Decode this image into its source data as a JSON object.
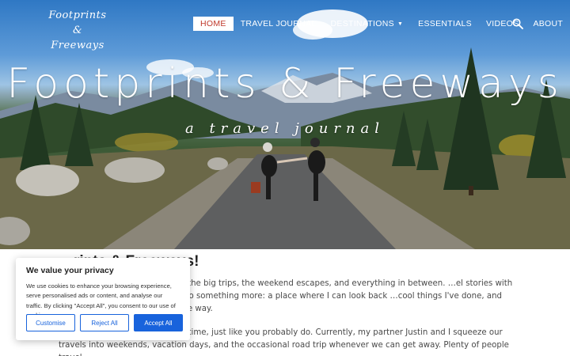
{
  "site": {
    "logo_line1": "Footprints &",
    "logo_line2": "Freeways"
  },
  "nav": {
    "items": [
      {
        "label": "HOME",
        "active": true
      },
      {
        "label": "TRAVEL JOURNAL"
      },
      {
        "label": "DESTINATIONS",
        "has_dropdown": true
      },
      {
        "label": "ESSENTIALS"
      },
      {
        "label": "VIDEOS"
      },
      {
        "label": "ABOUT"
      }
    ],
    "search_icon": "search-icon"
  },
  "hero": {
    "title": "Footprints & Freeways",
    "tagline": "a travel journal"
  },
  "content": {
    "heading": "…rints & Freeways!",
    "para1": "…tal scrapbook of adventures—the big trips, the weekend escapes, and everything in between. …el stories with my family. Over time, it grew into something more: a place where I can look back …cool things I've done, and yes, even the mistakes along the way.",
    "para2": "…or a digital nomad. I work full-time, just like you probably do. Currently, my partner Justin and I squeeze our travels into weekends, vacation days, and the occasional road trip whenever we can get away. Plenty of people travel"
  },
  "cookie": {
    "title": "We value your privacy",
    "text": "We use cookies to enhance your browsing experience, serve personalised ads or content, and analyse our traffic. By clicking \"Accept All\", you consent to our use of cookies.",
    "buttons": {
      "customise": "Customise",
      "reject": "Reject All",
      "accept": "Accept All"
    }
  },
  "colors": {
    "nav_active_text": "#c0392b",
    "cookie_accent": "#1863dc"
  }
}
